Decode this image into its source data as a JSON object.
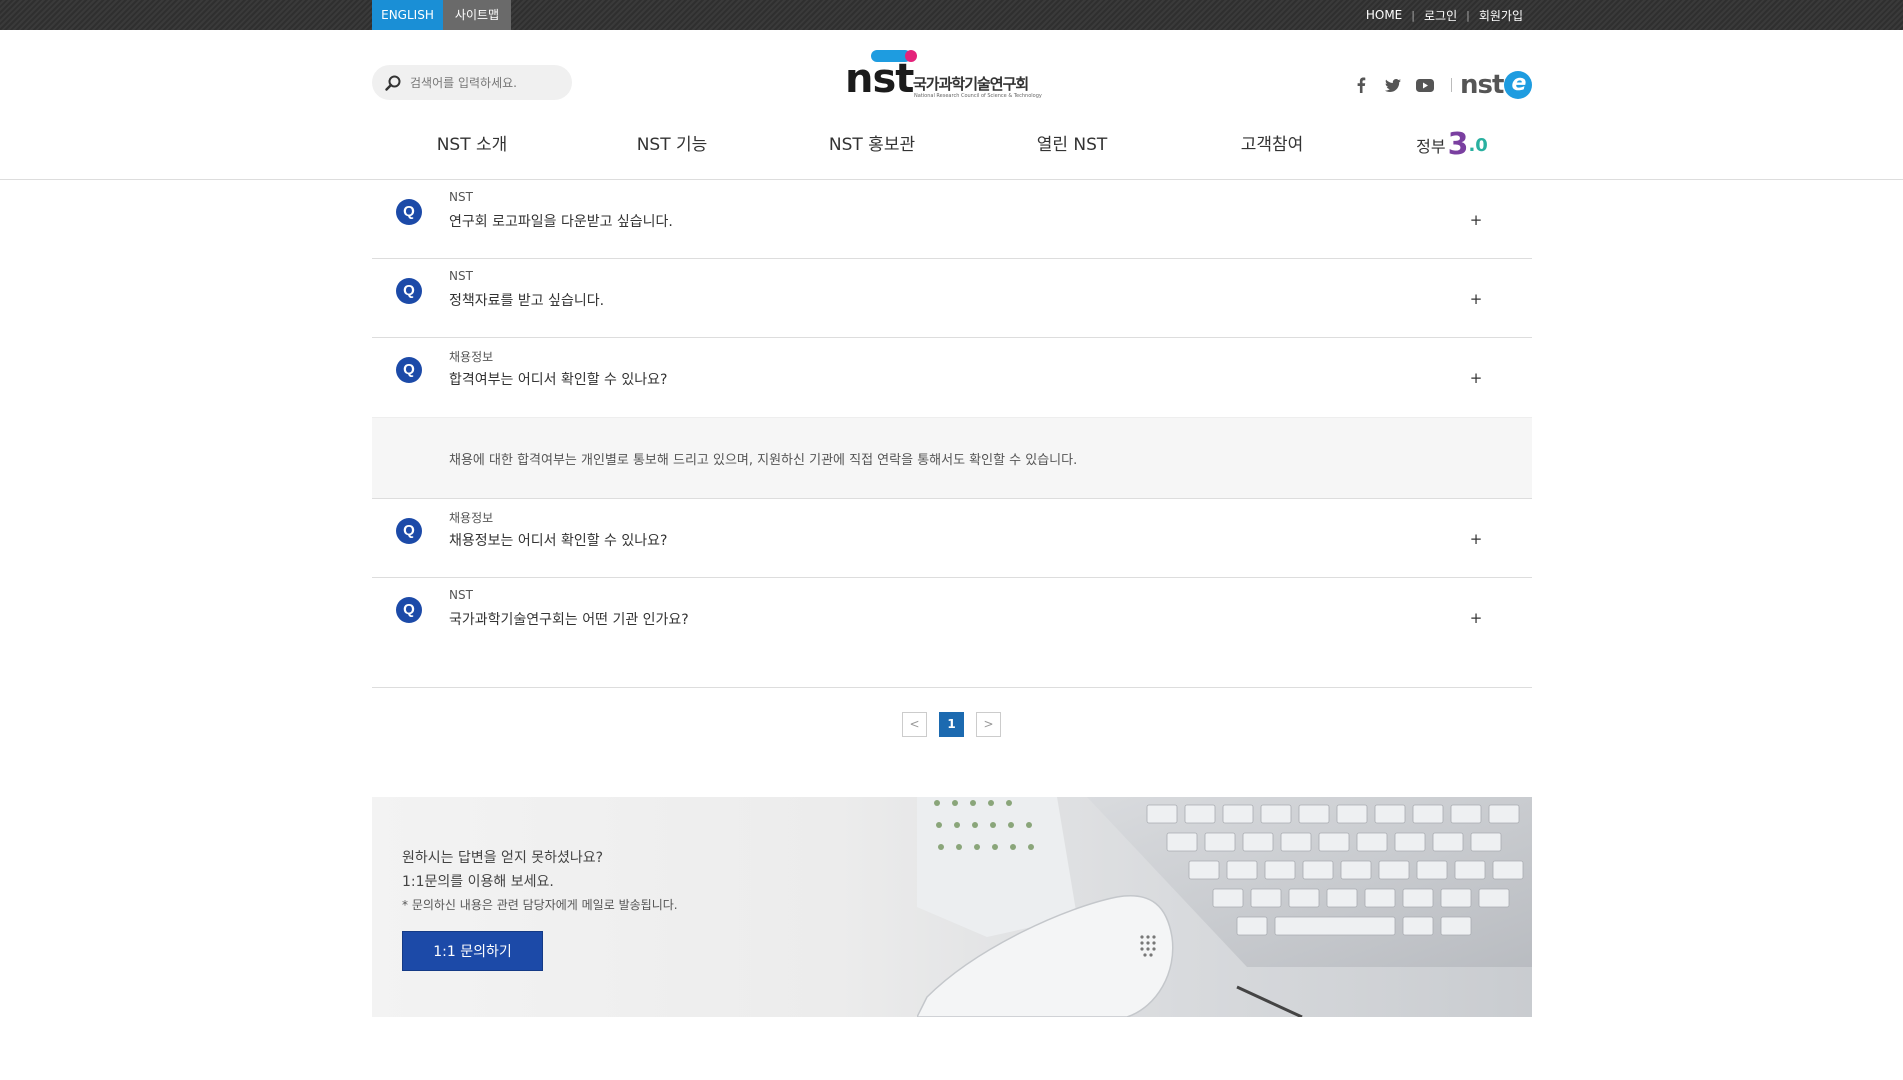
{
  "topbar": {
    "english_label": "ENGLISH",
    "sitemap_label": "사이트맵",
    "util": [
      "HOME",
      "로그인",
      "회원가입"
    ]
  },
  "search": {
    "placeholder": "검색어를 입력하세요."
  },
  "logo": {
    "word": "nst",
    "korean_name": "국가과학기술연구회",
    "english_name": "National Research Council of Science & Technology",
    "brand_blue": "#1e9ce0",
    "brand_pink": "#e4237a"
  },
  "social": {
    "icons": [
      "facebook-icon",
      "twitter-icon",
      "youtube-icon"
    ],
    "nste_label": "nst",
    "nste_e": "e"
  },
  "gnb": {
    "menus": [
      "NST 소개",
      "NST 기능",
      "NST 홍보관",
      "열린 NST",
      "고객참여"
    ],
    "gov_text": "정부",
    "gov_num": "3",
    "gov_dec": ".0"
  },
  "faq": {
    "q_mark": "Q",
    "plus": "+",
    "items": [
      {
        "category": "NST",
        "question": "연구회 로고파일을 다운받고 싶습니다."
      },
      {
        "category": "NST",
        "question": "정책자료를 받고 싶습니다."
      },
      {
        "category": "채용정보",
        "question": "합격여부는 어디서 확인할 수 있나요?",
        "answer": "채용에 대한 합격여부는 개인별로 통보해 드리고 있으며, 지원하신 기관에 직접 연락을 통해서도 확인할 수 있습니다."
      },
      {
        "category": "채용정보",
        "question": "채용정보는 어디서 확인할 수 있나요?"
      },
      {
        "category": "NST",
        "question": "국가과학기술연구회는 어떤 기관 인가요?"
      }
    ]
  },
  "paging": {
    "prev": "<",
    "current": "1",
    "next": ">"
  },
  "banner": {
    "line1": "원하시는 답변을 얻지 못하셨나요?",
    "line2": "1:1문의를 이용해 보세요.",
    "note": "* 문의하신 내용은 관련 담당자에게 메일로 발송됩니다.",
    "button": "1:1 문의하기",
    "button_color": "#1c4aa8"
  }
}
